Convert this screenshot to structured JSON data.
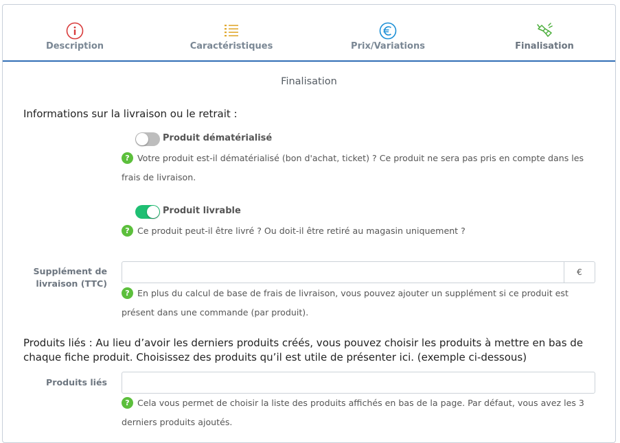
{
  "tabs": [
    {
      "label": "Description",
      "icon": "info-circle-icon",
      "color": "#d83a3a"
    },
    {
      "label": "Caractéristiques",
      "icon": "list-icon",
      "color": "#e0a82e"
    },
    {
      "label": "Prix/Variations",
      "icon": "euro-circle-icon",
      "color": "#1b8fd6"
    },
    {
      "label": "Finalisation",
      "icon": "handshake-icon",
      "color": "#4cae3c"
    }
  ],
  "active_tab": "Finalisation",
  "section_title": "Finalisation",
  "delivery": {
    "heading": "Informations sur la livraison ou le retrait :",
    "dematerialized": {
      "label": "Produit dématérialisé",
      "checked": false,
      "help": "Votre produit est-il dématérialisé (bon d'achat, ticket) ? Ce produit ne sera pas pris en compte dans les frais de livraison."
    },
    "deliverable": {
      "label": "Produit livrable",
      "checked": true,
      "help": "Ce produit peut-il être livré ? Ou doit-il être retiré au magasin uniquement ?"
    },
    "supplement": {
      "label_line1": "Supplément de",
      "label_line2": "livraison (TTC)",
      "value": "",
      "addon": "€",
      "help": "En plus du calcul de base de frais de livraison, vous pouvez ajouter un supplément si ce produit est présent dans une commande (par produit)."
    }
  },
  "related": {
    "paragraph": "Produits liés : Au lieu d’avoir les derniers produits créés, vous pouvez choisir les produits à mettre en bas de chaque fiche produit. Choisissez des produits qu’il est utile de présenter ici. (exemple ci-dessous)",
    "label": "Produits liés",
    "value": "",
    "help": "Cela vous permet de choisir la liste des produits affichés en bas de la page. Par défaut, vous avez les 3 derniers produits ajoutés."
  },
  "help_marker": "?",
  "colors": {
    "accent": "#2f6db5",
    "toggle_on": "#1fbf73",
    "help_badge": "#5cbf3c"
  }
}
